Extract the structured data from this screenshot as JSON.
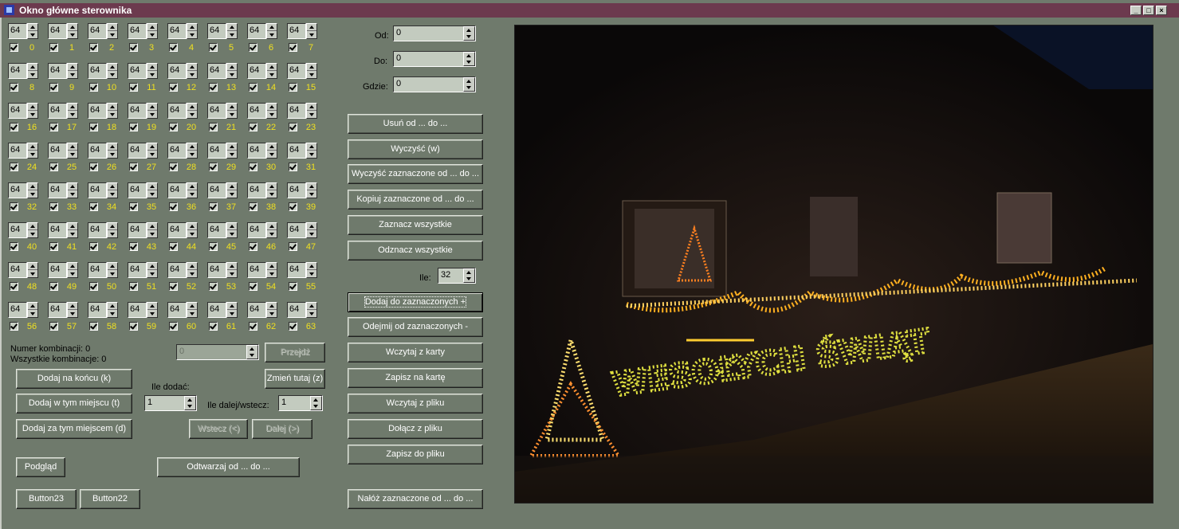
{
  "window": {
    "title": "Okno główne sterownika"
  },
  "spin_default": "64",
  "channels": [
    "0",
    "1",
    "2",
    "3",
    "4",
    "5",
    "6",
    "7",
    "8",
    "9",
    "10",
    "11",
    "12",
    "13",
    "14",
    "15",
    "16",
    "17",
    "18",
    "19",
    "20",
    "21",
    "22",
    "23",
    "24",
    "25",
    "26",
    "27",
    "28",
    "29",
    "30",
    "31",
    "32",
    "33",
    "34",
    "35",
    "36",
    "37",
    "38",
    "39",
    "40",
    "41",
    "42",
    "43",
    "44",
    "45",
    "46",
    "47",
    "48",
    "49",
    "50",
    "51",
    "52",
    "53",
    "54",
    "55",
    "56",
    "57",
    "58",
    "59",
    "60",
    "61",
    "62",
    "63"
  ],
  "range": {
    "od_label": "Od:",
    "od_value": "0",
    "do_label": "Do:",
    "do_value": "0",
    "gdzie_label": "Gdzie:",
    "gdzie_value": "0"
  },
  "ile": {
    "label": "Ile:",
    "value": "32"
  },
  "right_buttons": {
    "usun": "Usuń od ... do ...",
    "wyczysc": "Wyczyść (w)",
    "wyczysc_zazn": "Wyczyść zaznaczone od ... do ...",
    "kopiuj": "Kopiuj zaznaczone od ... do ...",
    "zaznacz": "Zaznacz wszystkie",
    "odznacz": "Odznacz wszystkie",
    "dodaj_zazn": "Dodaj do zaznaczonych +",
    "odejmij_zazn": "Odejmij od zaznaczonych -",
    "wczytaj_karty": "Wczytaj z karty",
    "zapisz_karte": "Zapisz na kartę",
    "wczytaj_pliku": "Wczytaj z pliku",
    "dolacz_pliku": "Dołącz z pliku",
    "zapisz_pliku": "Zapisz do pliku",
    "naloz": "Nałóż zaznaczone od ... do ..."
  },
  "combo": {
    "numer_label": "Numer kombinacji: 0",
    "wszystkie_label": "Wszystkie kombinacje: 0",
    "combo_value": "0",
    "przejdz": "Przejdź",
    "zmien": "Zmień tutaj (z)",
    "dodaj_koniec": "Dodaj na końcu (k)",
    "dodaj_miejscu": "Dodaj w tym miejscu (t)",
    "dodaj_za": "Dodaj za tym miejscem (d)",
    "ile_dodac_label": "Ile dodać:",
    "ile_dodac_value": "1",
    "ile_dalej_label": "Ile dalej/wstecz:",
    "ile_dalej_value": "1",
    "wstecz": "Wstecz (<)",
    "dalej": "Dalej (>)",
    "podglad": "Podgląd",
    "odtwarzaj": "Odtwarzaj od ... do ...",
    "button23": "Button23",
    "button22": "Button22"
  },
  "photo": {
    "text": "WESOŁYCH ŚWIĄT"
  }
}
